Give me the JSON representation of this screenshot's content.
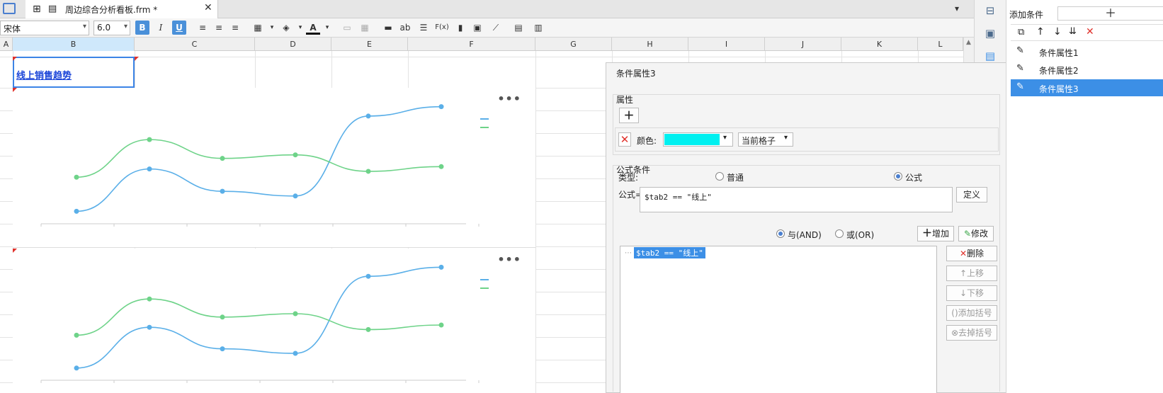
{
  "tabs": {
    "doc_title": "周边综合分析看板.frm *"
  },
  "toolbar": {
    "font_name": "宋体",
    "font_size": "6.0",
    "bold": "B",
    "italic": "I",
    "underline": "U",
    "text_tool": "ab",
    "formula_tool": "F(x)"
  },
  "columns": [
    "A",
    "B",
    "C",
    "D",
    "E",
    "F",
    "G",
    "H",
    "I",
    "J",
    "K",
    "L"
  ],
  "sheet": {
    "title_cell": "线上销售趋势"
  },
  "charts": [
    {
      "series": [
        {
          "color": "#5aafe8",
          "values": [
            32,
            68,
            49,
            45,
            113,
            121
          ]
        },
        {
          "color": "#6ed389",
          "values": [
            61,
            93,
            77,
            80,
            66,
            70
          ]
        }
      ]
    },
    {
      "series": [
        {
          "color": "#5aafe8",
          "values": [
            32,
            68,
            49,
            45,
            113,
            121
          ]
        },
        {
          "color": "#6ed389",
          "values": [
            61,
            93,
            77,
            80,
            66,
            70
          ]
        }
      ]
    }
  ],
  "dialog": {
    "title": "条件属性3",
    "attr_group": "属性",
    "color_label": "颜色:",
    "color_value": "#00f0f0",
    "scope": "当前格子",
    "formula_group": "公式条件",
    "type_label": "类型:",
    "type_normal": "普通",
    "type_formula": "公式",
    "formula_label": "公式=",
    "formula_value": "$tab2 == \"线上\"",
    "define_btn": "定义",
    "and_label": "与(AND)",
    "or_label": "或(OR)",
    "add_btn": "增加",
    "modify_btn": "修改",
    "list_item": "$tab2 == \"线上\"",
    "delete_btn": "删除",
    "up_btn": "上移",
    "down_btn": "下移",
    "add_bracket_btn": "添加括号",
    "remove_bracket_btn": "去掉括号"
  },
  "right_panel": {
    "add_condition": "添加条件",
    "items": [
      "条件属性1",
      "条件属性2",
      "条件属性3"
    ]
  }
}
